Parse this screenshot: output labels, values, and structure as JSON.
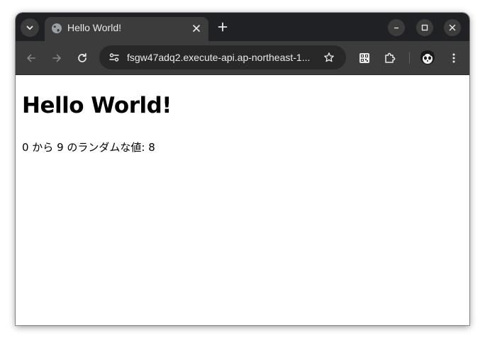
{
  "browser": {
    "tab": {
      "title": "Hello World!",
      "favicon": "globe-icon"
    },
    "address_bar": {
      "url": "fsgw47adq2.execute-api.ap-northeast-1..."
    },
    "icons": {
      "tab_search": "chevron-down-icon",
      "tab_close": "close-icon",
      "new_tab": "plus-icon",
      "minimize": "minimize-icon",
      "maximize": "maximize-icon",
      "close_window": "close-icon",
      "back": "arrow-left-icon",
      "forward": "arrow-right-icon",
      "reload": "reload-icon",
      "site_info": "tune-icon",
      "bookmark": "star-icon",
      "qr_code": "qr-code-icon",
      "extensions": "puzzle-icon",
      "profile": "avatar",
      "menu": "more-vertical-icon"
    },
    "colors": {
      "tabstrip_bg": "#202124",
      "toolbar_bg": "#3c3c3c",
      "omnibox_bg": "#282828",
      "text": "#e8eaed"
    }
  },
  "page": {
    "heading": "Hello World!",
    "text": "0 から 9 のランダムな値: 8"
  }
}
